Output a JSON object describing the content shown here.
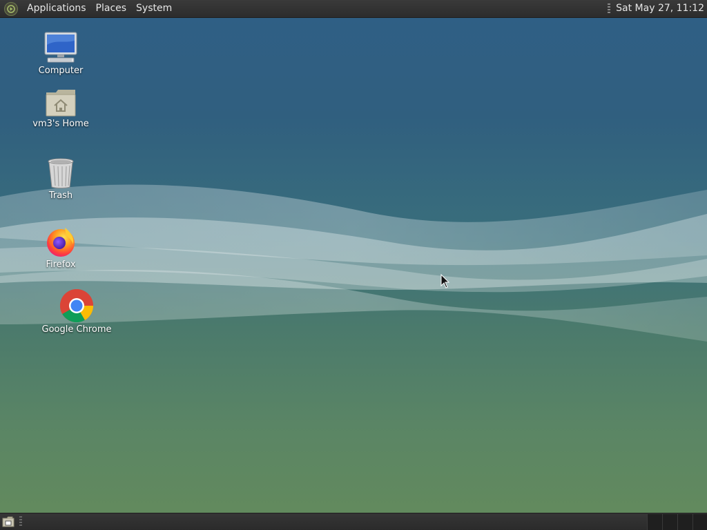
{
  "top_panel": {
    "menus": [
      "Applications",
      "Places",
      "System"
    ],
    "clock": "Sat May 27, 11:12"
  },
  "desktop": {
    "icons": [
      {
        "label": "Computer",
        "icon": "computer-icon"
      },
      {
        "label": "vm3's Home",
        "icon": "home-folder-icon"
      },
      {
        "label": "Trash",
        "icon": "trash-icon"
      },
      {
        "label": "Firefox",
        "icon": "firefox-icon"
      },
      {
        "label": "Google Chrome",
        "icon": "chrome-icon"
      }
    ]
  },
  "bottom_panel": {
    "show_desktop_icon": "show-desktop-icon",
    "workspaces": 4
  },
  "colors": {
    "panel": "#2f2f2f",
    "panel_text": "#e6e6e6",
    "desktop_top": "#2f5f86",
    "desktop_bottom": "#648b5c"
  }
}
